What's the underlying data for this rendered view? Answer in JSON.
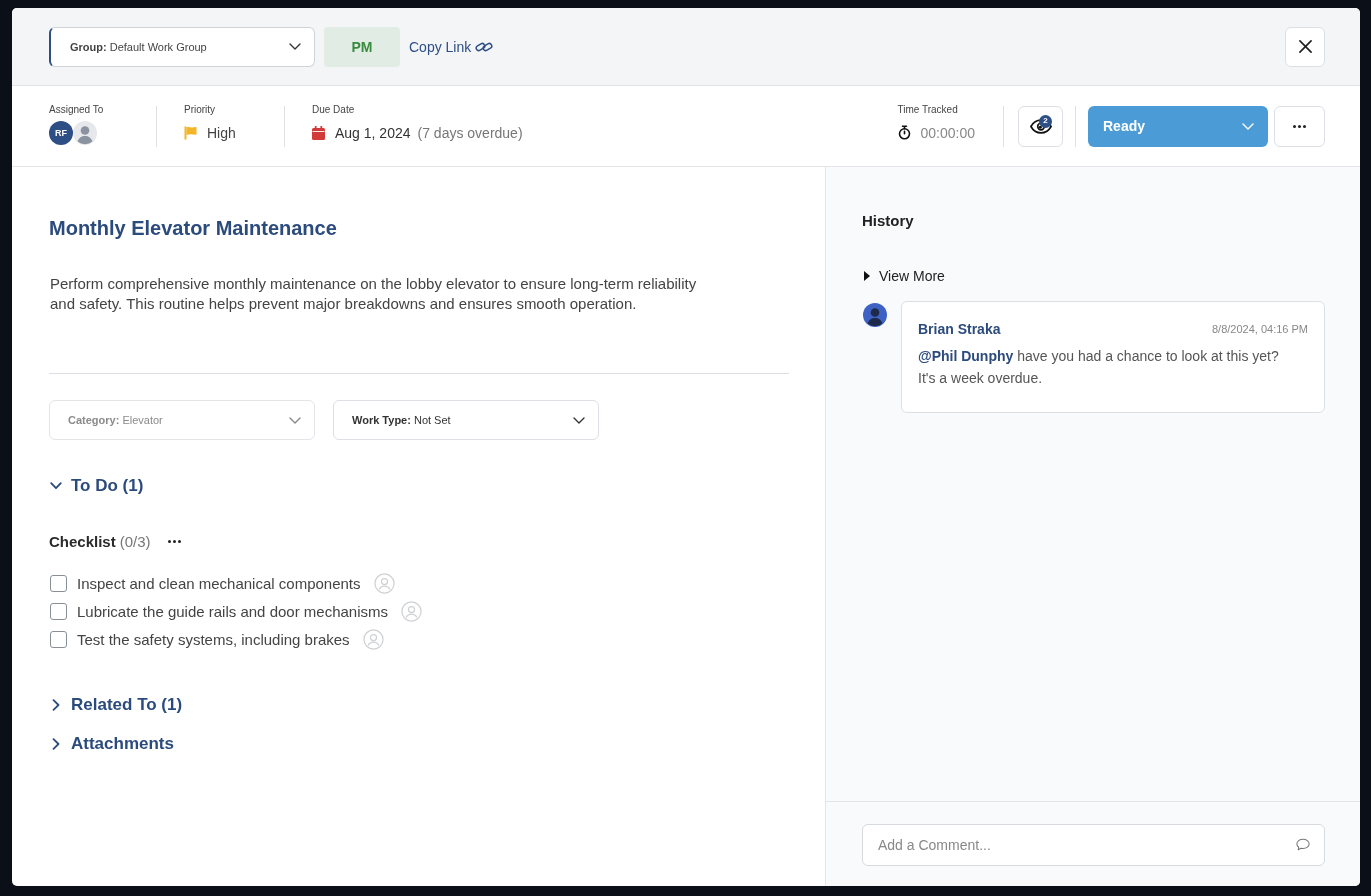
{
  "header": {
    "group": {
      "label": "Group:",
      "value": "Default Work Group"
    },
    "type_tag": "PM",
    "copy_link": "Copy Link"
  },
  "details": {
    "assigned_to": {
      "label": "Assigned To",
      "assignees": [
        {
          "kind": "initials",
          "initials": "RF"
        },
        {
          "kind": "photo"
        }
      ]
    },
    "priority": {
      "label": "Priority",
      "value": "High"
    },
    "due_date": {
      "label": "Due Date",
      "value": "Aug 1, 2024",
      "note": "(7 days overdue)"
    },
    "time_tracked": {
      "label": "Time Tracked",
      "value": "00:00:00"
    },
    "watchers": {
      "count": "2"
    },
    "status": {
      "value": "Ready"
    }
  },
  "task": {
    "title": "Monthly Elevator Maintenance",
    "description": "Perform comprehensive monthly maintenance on the lobby elevator to ensure long-term reliability and safety. This routine helps prevent major breakdowns and ensures smooth operation.",
    "fields": [
      {
        "label": "Category:",
        "value": "Elevator",
        "disabled": true
      },
      {
        "label": "Work Type:",
        "value": "Not Set",
        "disabled": false
      }
    ],
    "sections": [
      {
        "title": "To Do (1)",
        "expanded": true,
        "checklist": {
          "title": "Checklist",
          "count": "(0/3)",
          "items": [
            {
              "text": "Inspect and clean mechanical components",
              "checked": false
            },
            {
              "text": "Lubricate the guide rails and door mechanisms",
              "checked": false
            },
            {
              "text": "Test the safety systems, including brakes",
              "checked": false
            }
          ]
        }
      },
      {
        "title": "Related To (1)",
        "expanded": false
      },
      {
        "title": "Attachments",
        "expanded": false
      }
    ]
  },
  "history": {
    "title": "History",
    "view_more": "View More",
    "comments": [
      {
        "author": "Brian Straka",
        "time": "8/8/2024, 04:16 PM",
        "text": "**@Phil Dunphy** have you had a chance to look at this yet? It's a week overdue."
      }
    ]
  },
  "comment_box": {
    "placeholder": "Add a Comment..."
  }
}
